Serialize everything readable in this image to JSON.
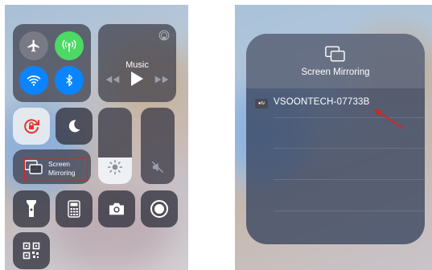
{
  "control_center": {
    "music": {
      "title": "Music"
    },
    "screen_mirroring": {
      "line1": "Screen",
      "line2": "Mirroring"
    },
    "brightness_level": 0.35,
    "colors": {
      "airplane": "#7a7a86",
      "cellular": "#4cd964",
      "wifi": "#0a84ff",
      "bluetooth": "#0a84ff",
      "accent_red": "#d22"
    }
  },
  "mirroring_panel": {
    "title": "Screen Mirroring",
    "devices": [
      {
        "name": "VSOONTECH-07733B",
        "badge": "●tv"
      }
    ]
  }
}
